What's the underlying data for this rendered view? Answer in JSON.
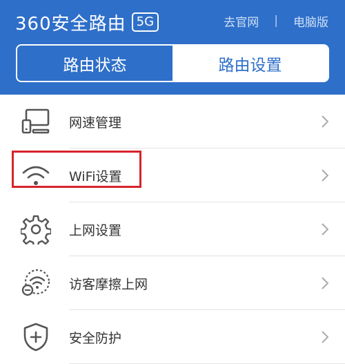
{
  "header": {
    "brand": "360安全路由",
    "brand_badge": "5G",
    "links": {
      "official_site": "去官网",
      "separator": "|",
      "pc_version": "电脑版"
    }
  },
  "tabs": [
    {
      "label": "路由状态",
      "active": false
    },
    {
      "label": "路由设置",
      "active": true
    }
  ],
  "menu": {
    "items": [
      {
        "label": "网速管理",
        "icon": "speed-management-icon"
      },
      {
        "label": "WiFi设置",
        "icon": "wifi-icon",
        "highlighted": true
      },
      {
        "label": "上网设置",
        "icon": "gear-icon"
      },
      {
        "label": "访客摩擦上网",
        "icon": "guest-wifi-icon"
      },
      {
        "label": "安全防护",
        "icon": "shield-plus-icon"
      }
    ]
  },
  "colors": {
    "header_bg": "#2e6fc9",
    "highlight": "#d8232a",
    "icon": "#555555"
  }
}
